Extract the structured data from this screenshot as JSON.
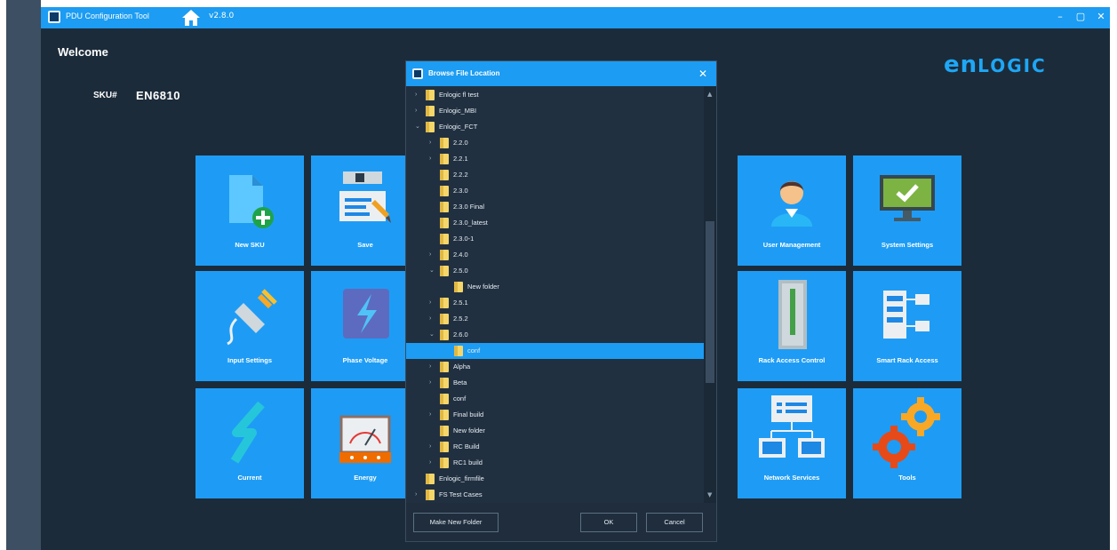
{
  "window": {
    "title": "PDU Configuration Tool",
    "version": "v2.8.0",
    "minimize": "–",
    "restore": "▢",
    "close": "✕"
  },
  "main": {
    "welcome": "Welcome",
    "sku_label": "SKU#",
    "sku_value": "EN6810",
    "logo": {
      "prefix": "en",
      "suffix": "LOGIC"
    }
  },
  "tiles": [
    {
      "label": "New SKU",
      "icon": "new-file-icon"
    },
    {
      "label": "Save",
      "icon": "save-icon"
    },
    {
      "label": "User Management",
      "icon": "user-icon"
    },
    {
      "label": "System Settings",
      "icon": "monitor-check-icon"
    },
    {
      "label": "Input Settings",
      "icon": "plug-icon"
    },
    {
      "label": "Phase Voltage",
      "icon": "lightning-icon"
    },
    {
      "label": "Rack Access Control",
      "icon": "rack-door-icon"
    },
    {
      "label": "Smart Rack Access",
      "icon": "server-network-icon"
    },
    {
      "label": "Current",
      "icon": "current-icon"
    },
    {
      "label": "Energy",
      "icon": "meter-icon"
    },
    {
      "label": "Network Services",
      "icon": "network-icon"
    },
    {
      "label": "Tools",
      "icon": "gears-icon"
    }
  ],
  "dialog": {
    "title": "Browse File Location",
    "close": "✕",
    "tree": [
      {
        "name": "Enlogic fl test",
        "level": 1,
        "arrow": "›"
      },
      {
        "name": "Enlogic_MBI",
        "level": 1,
        "arrow": "›"
      },
      {
        "name": "Enlogic_FCT",
        "level": 1,
        "arrow": "⌄"
      },
      {
        "name": "2.2.0",
        "level": 2,
        "arrow": "›"
      },
      {
        "name": "2.2.1",
        "level": 2,
        "arrow": "›"
      },
      {
        "name": "2.2.2",
        "level": 2,
        "arrow": ""
      },
      {
        "name": "2.3.0",
        "level": 2,
        "arrow": ""
      },
      {
        "name": "2.3.0 Final",
        "level": 2,
        "arrow": ""
      },
      {
        "name": "2.3.0_latest",
        "level": 2,
        "arrow": ""
      },
      {
        "name": "2.3.0-1",
        "level": 2,
        "arrow": ""
      },
      {
        "name": "2.4.0",
        "level": 2,
        "arrow": "›"
      },
      {
        "name": "2.5.0",
        "level": 2,
        "arrow": "⌄"
      },
      {
        "name": "New folder",
        "level": 3,
        "arrow": ""
      },
      {
        "name": "2.5.1",
        "level": 2,
        "arrow": "›"
      },
      {
        "name": "2.5.2",
        "level": 2,
        "arrow": "›"
      },
      {
        "name": "2.6.0",
        "level": 2,
        "arrow": "⌄"
      },
      {
        "name": "conf",
        "level": 3,
        "arrow": "",
        "selected": true
      },
      {
        "name": "Alpha",
        "level": 2,
        "arrow": "›"
      },
      {
        "name": "Beta",
        "level": 2,
        "arrow": "›"
      },
      {
        "name": "conf",
        "level": 2,
        "arrow": ""
      },
      {
        "name": "Final build",
        "level": 2,
        "arrow": "›"
      },
      {
        "name": "New folder",
        "level": 2,
        "arrow": ""
      },
      {
        "name": "RC Build",
        "level": 2,
        "arrow": "›"
      },
      {
        "name": "RC1 build",
        "level": 2,
        "arrow": "›"
      },
      {
        "name": "Enlogic_firmfile",
        "level": 1,
        "arrow": ""
      },
      {
        "name": "FS Test Cases",
        "level": 1,
        "arrow": "›"
      }
    ],
    "buttons": {
      "new_folder": "Make New Folder",
      "ok": "OK",
      "cancel": "Cancel"
    }
  },
  "colors": {
    "accent": "#1c9cf2",
    "tile": "#1e9cf5",
    "background": "#1c2b3a",
    "folder": "#f5d66b"
  }
}
